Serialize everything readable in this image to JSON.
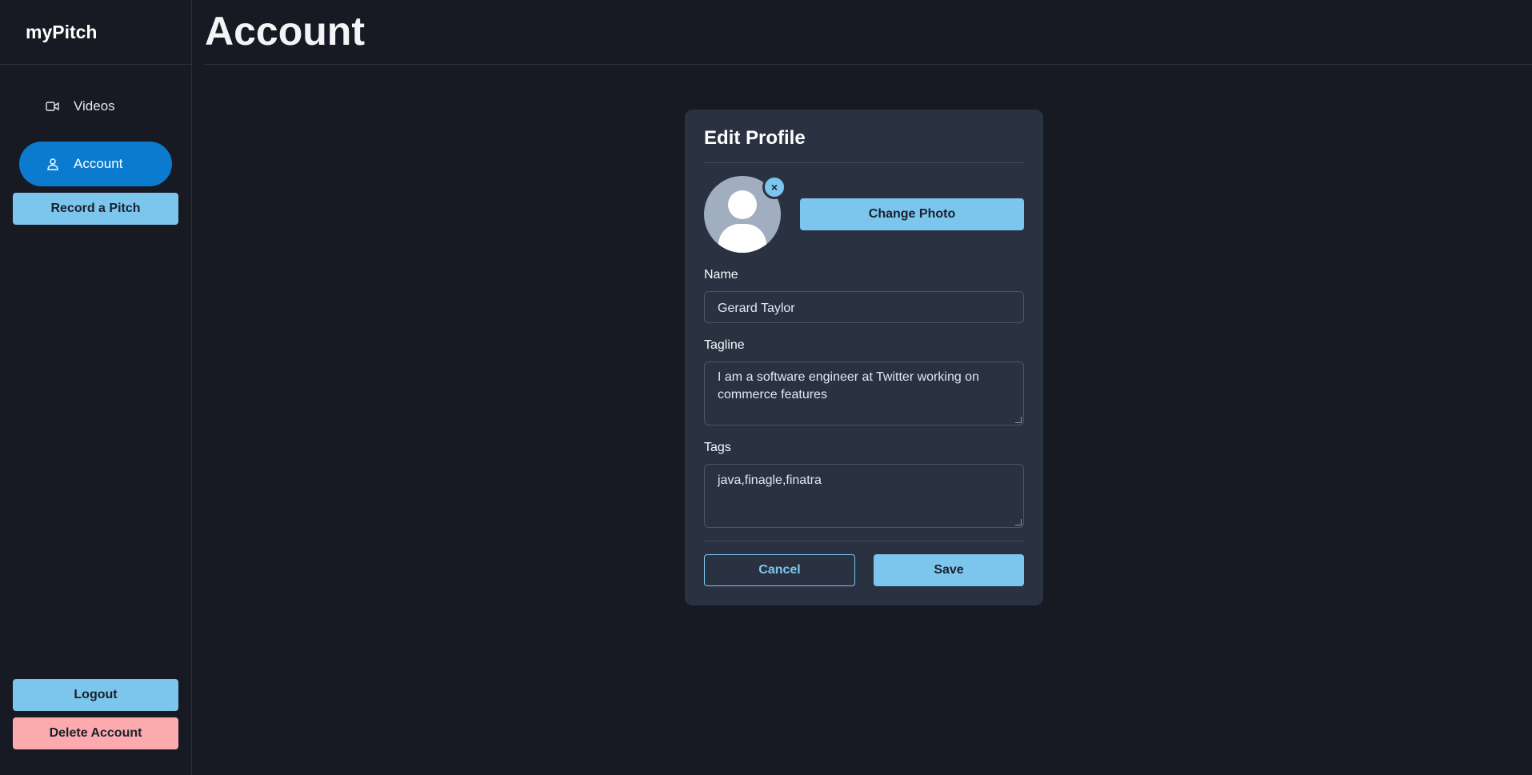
{
  "app": {
    "brand": "myPitch"
  },
  "sidebar": {
    "items": [
      {
        "label": "Videos",
        "icon": "video-icon",
        "active": false
      },
      {
        "label": "Account",
        "icon": "user-icon",
        "active": true
      }
    ],
    "record_label": "Record a Pitch",
    "logout_label": "Logout",
    "delete_label": "Delete Account"
  },
  "header": {
    "title": "Account"
  },
  "modal": {
    "title": "Edit Profile",
    "remove_photo_glyph": "×",
    "change_photo_label": "Change Photo",
    "name": {
      "label": "Name",
      "value": "Gerard Taylor"
    },
    "tagline": {
      "label": "Tagline",
      "value": "I am a software engineer at Twitter working on commerce features"
    },
    "tags": {
      "label": "Tags",
      "value": "java,finagle,finatra"
    },
    "cancel_label": "Cancel",
    "save_label": "Save"
  },
  "colors": {
    "background": "#171923",
    "modal": "#2a3242",
    "accent": "#7cc6ee",
    "active_nav": "#0b7bcf",
    "danger": "#fcaaae"
  }
}
